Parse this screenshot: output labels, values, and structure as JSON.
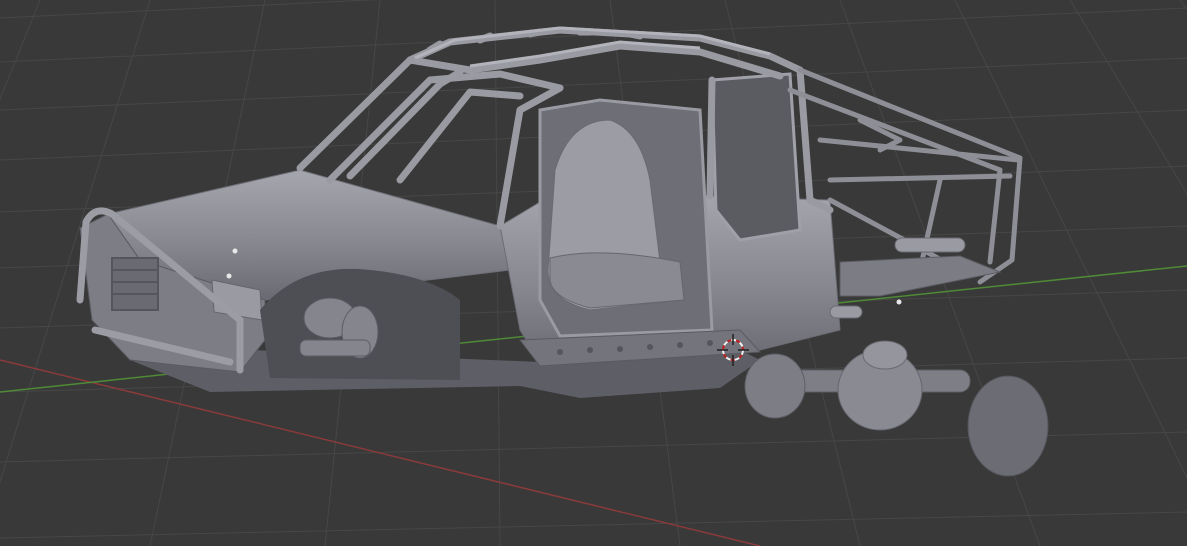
{
  "viewport": {
    "background": "#393939",
    "grid_color": "#484848",
    "x_axis_color": "#8a3a3a",
    "y_axis_color": "#4f8a36",
    "model_color": "#8e8e96",
    "model_shadow_color": "#5e5e66",
    "model_highlight_color": "#b6b6be",
    "cursor_icon": "3d-cursor-icon"
  }
}
